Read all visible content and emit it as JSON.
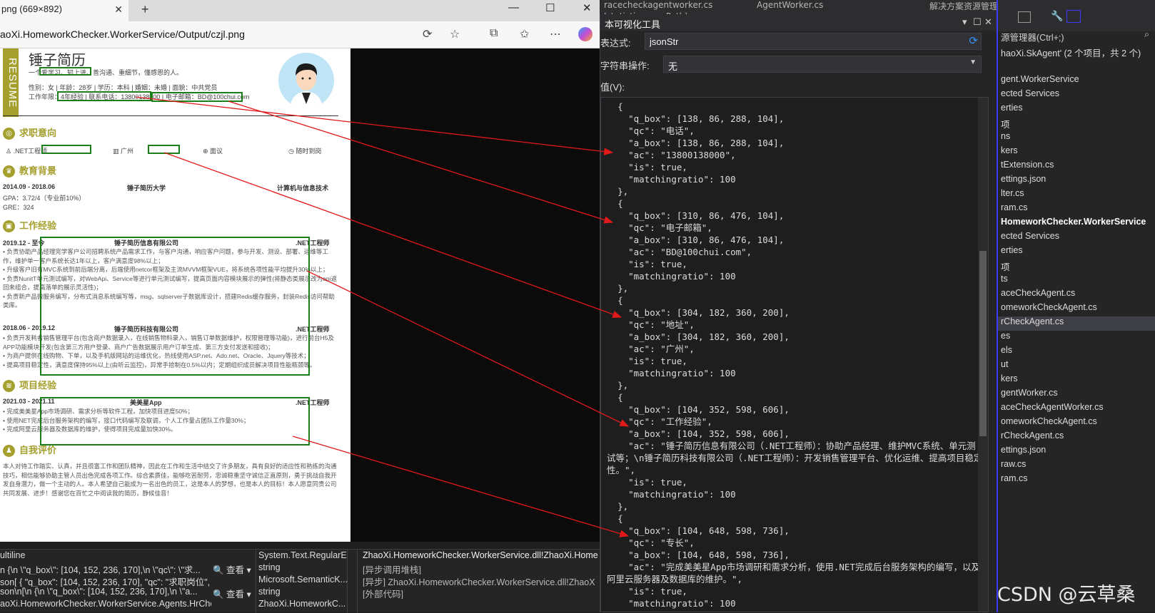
{
  "ide_top": {
    "fragments": [
      "racecheckagentworker.cs",
      "AgentWorker.cs",
      "Istatisticscore.Path)",
      "解决方案资源管理器"
    ]
  },
  "browser": {
    "tab_title": "png (669×892)",
    "tab_close": "✕",
    "new_tab": "+",
    "window_controls": [
      "—",
      "☐",
      "✕"
    ],
    "url": "aoXi.HomeworkChecker.WorkerService/Output/czjl.png",
    "toolbar_icons": [
      "refresh-translate-icon",
      "favorite-star-icon",
      "extensions-icon",
      "favorites-list-icon",
      "more-icon",
      "copilot-icon"
    ]
  },
  "resume": {
    "band_text": "RESUME",
    "name": "锤子简历",
    "motto": "一个爱学习、知上进、善沟通、重细节，懂感恩的人。",
    "personal_line": "性别：女 | 年龄：28岁 | 学历：本科 | 婚姻：未婚 | 面貌：中共党员",
    "contact_line": "工作年限：4年经验 | 联系电话：13800138000 | 电子邮箱：BD@100chui.com",
    "intent": {
      "title": "求职意向",
      "job": ".NET工程师",
      "city": "广州",
      "salary": "面议",
      "arrival": "随时到岗"
    },
    "education": {
      "title": "教育背景",
      "period": "2014.09 - 2018.06",
      "school": "锤子简历大学",
      "major": "计算机与信息技术",
      "gpa": "GPA：3.72/4（专业前10%）",
      "gre": "GRE：324"
    },
    "work": {
      "title": "工作经验",
      "job1": {
        "period": "2019.12 - 至今",
        "company": "锤子简历信息有限公司",
        "role": ".NET工程师",
        "desc": "• 负责协助产品经理完学客户公司招聘系统产品需求工作，与客户沟通，响应客户问题，参与开发、测设、部署、运维等工作，维护单一客户系统长达1年以上，客户满意度98%以上；\n• 升级客户旧有MVC系统到前后端分离，后端使用netcor框架及主流MVVM框架VUE，将系统各项性能平均提升30%以上；\n• 负责NunitT单元测试编写，对WebApi、Service等进行单元测试编写，提高页面内容模块展示的弹性(将静态类展示改为api返回来组合，提高落单的展示灵活性)；\n• 负责新产品微服务编写，分布式消息系统编写等，msg、sqlserver子数据库设计，搭建Redis缓存服务，封装Redis访问帮助类库。"
      },
      "job2": {
        "period": "2018.06 - 2019.12",
        "company": "锤子简历科技有限公司",
        "role": ".NET工程师",
        "desc": "• 负责开发耗者销售管理平台(包含商户数据录入，在线销售物料录入，销售订单数据维护，权限管理等功能)，进行前台H5及APP功能模块开发(包含第三方用户登录、商户广告数据展示用户订单生成、第三方支付发送和接收)；\n• 为商户提供在线购物、下单，以及手机版网站的运维优化，热线使用ASP.net、Ado.net、Oracle、Jquery等技术；\n• 提高项目稳定性，满意度保持95%以上(由听云监控)，异常手拾制在0.5%以内；定期组织成员解决项目性能瓶颈等。"
      }
    },
    "projects": {
      "title": "项目经验",
      "period": "2021.03 - 2021.11",
      "name": "美美星App",
      "role": ".NET工程师",
      "desc": "• 完成美美星App市场调研、需求分析等软件工程，加快项目进度50%；\n• 使用NET完成后台服务架构的编写，接口代码编写及联调，个人工作量占团队工作量30%；\n• 完成阿里云服务器及数据库的维护，使得项目完成量加快30%。"
    },
    "self": {
      "title": "自我评价",
      "desc": "本人对待工作踏实、认真，并且很富工作和团队精神，因此在工作和生活中结交了许多朋友，具有良好的适应性和熟练的沟通技巧，相信能够协助主管人员出色完成各项工作。综合素质佳，能够吃苦耐劳，忠诚稳重坚守诚信正直原则，勇于挑战自我开发自身潜力，做一个主动的人。本人希望自己能成为一名出色的员工，这是本人的梦想，也是本人的目标！本人愿意同贵公司共同发展、进步！感谢您在百忙之中阅读我的简历，静候佳音！"
    }
  },
  "visualizer": {
    "title": "本可视化工具",
    "title_controls": [
      "▾",
      "☐",
      "✕"
    ],
    "expr_label": "表达式:",
    "expr_value": "jsonStr",
    "string_op_label": "字符串操作:",
    "string_op_value": "无",
    "value_label": "值(V):",
    "json_text": "  {\n    \"q_box\": [138, 86, 288, 104],\n    \"qc\": \"电话\",\n    \"a_box\": [138, 86, 288, 104],\n    \"ac\": \"13800138000\",\n    \"is\": true,\n    \"matchingratio\": 100\n  },\n  {\n    \"q_box\": [310, 86, 476, 104],\n    \"qc\": \"电子邮箱\",\n    \"a_box\": [310, 86, 476, 104],\n    \"ac\": \"BD@100chui.com\",\n    \"is\": true,\n    \"matchingratio\": 100\n  },\n  {\n    \"q_box\": [304, 182, 360, 200],\n    \"qc\": \"地址\",\n    \"a_box\": [304, 182, 360, 200],\n    \"ac\": \"广州\",\n    \"is\": true,\n    \"matchingratio\": 100\n  },\n  {\n    \"q_box\": [104, 352, 598, 606],\n    \"qc\": \"工作经验\",\n    \"a_box\": [104, 352, 598, 606],\n    \"ac\": \"锤子简历信息有限公司（.NET工程师）：协助产品经理、维护MVC系统、单元测试等；\\n锤子简历科技有限公司（.NET工程师）：开发销售管理平台、优化运维、提高项目稳定性。\",\n    \"is\": true,\n    \"matchingratio\": 100\n  },\n  {\n    \"q_box\": [104, 648, 598, 736],\n    \"qc\": \"专长\",\n    \"a_box\": [104, 648, 598, 736],\n    \"ac\": \"完成美美星App市场调研和需求分析，使用.NET完成后台服务架构的编写，以及阿里云服务器及数据库的维护。\",\n    \"is\": true,\n    \"matchingratio\": 100"
  },
  "solution": {
    "search": "源管理器(Ctrl+;)",
    "items": [
      {
        "label": "haoXi.SkAgent' (2 个项目，共 2 个)",
        "style": "normal"
      },
      {
        "label": "",
        "style": "normal"
      },
      {
        "label": "gent.WorkerService",
        "style": "normal"
      },
      {
        "label": "ected Services",
        "style": "normal"
      },
      {
        "label": "erties",
        "style": "normal"
      },
      {
        "label": "项",
        "style": "normal"
      },
      {
        "label": "ns",
        "style": "normal"
      },
      {
        "label": "kers",
        "style": "normal"
      },
      {
        "label": "tExtension.cs",
        "style": "normal"
      },
      {
        "label": "ettings.json",
        "style": "normal"
      },
      {
        "label": "lter.cs",
        "style": "normal"
      },
      {
        "label": "ram.cs",
        "style": "normal"
      },
      {
        "label": "HomeworkChecker.WorkerService",
        "style": "bold"
      },
      {
        "label": "ected Services",
        "style": "normal"
      },
      {
        "label": "erties",
        "style": "normal"
      },
      {
        "label": "项",
        "style": "normal"
      },
      {
        "label": "ts",
        "style": "normal"
      },
      {
        "label": "aceCheckAgent.cs",
        "style": "normal"
      },
      {
        "label": "omeworkCheckAgent.cs",
        "style": "normal"
      },
      {
        "label": "rCheckAgent.cs",
        "style": "selected"
      },
      {
        "label": "es",
        "style": "normal"
      },
      {
        "label": "els",
        "style": "normal"
      },
      {
        "label": "ut",
        "style": "normal"
      },
      {
        "label": "kers",
        "style": "normal"
      },
      {
        "label": "gentWorker.cs",
        "style": "normal"
      },
      {
        "label": "aceCheckAgentWorker.cs",
        "style": "normal"
      },
      {
        "label": "omeworkCheckAgent.cs",
        "style": "normal"
      },
      {
        "label": "rCheckAgent.cs",
        "style": "normal"
      },
      {
        "label": "ettings.json",
        "style": "normal"
      },
      {
        "label": "raw.cs",
        "style": "normal"
      },
      {
        "label": "ram.cs",
        "style": "normal"
      }
    ]
  },
  "watermark": "CSDN @云草桑",
  "bottom": {
    "rows": [
      {
        "name": "ultiline",
        "value": "",
        "type": "System.Text.RegularE..."
      },
      {
        "name": "n {\\n  \\\"q_box\\\": [104, 152, 236, 170],\\n  \\\"qc\\\": \\\"求...",
        "value": "🔍 查看 ▾",
        "type": "string"
      },
      {
        "name": "son[  {    \"q_box\": [104, 152, 236, 170],    \"qc\": \"求职岗位\",    \"a_bo...",
        "value": "",
        "type": "Microsoft.SemanticK..."
      },
      {
        "name": "son\\n[\\n  {\\n  \\\"q_box\\\": [104, 152, 236, 170],\\n  \\\"a...",
        "value": "🔍 查看 ▾",
        "type": "string"
      },
      {
        "name": "aoXi.HomeworkChecker.WorkerService.Agents.HrCheckAgent}",
        "value": "",
        "type": "ZhaoXi.HomeworkC..."
      }
    ],
    "callstack": [
      "ZhaoXi.HomeworkChecker.WorkerService.dll!ZhaoXi.Home",
      "[异步调用堆栈]",
      "[异步] ZhaoXi.HomeworkChecker.WorkerService.dll!ZhaoX",
      "[外部代码]"
    ]
  }
}
